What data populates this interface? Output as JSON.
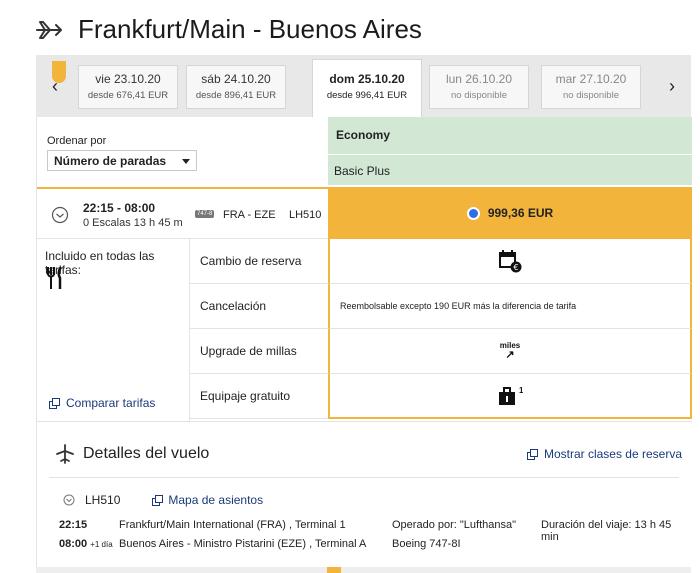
{
  "page": {
    "title": "Frankfurt/Main - Buenos Aires",
    "icons": {
      "title": "airplane-icon",
      "prev": "chevron-left-icon",
      "next": "chevron-right-icon"
    }
  },
  "dates": {
    "prev_label": "‹",
    "next_label": "›",
    "days": [
      {
        "label": "vie 23.10.20",
        "price": "desde 676,41 EUR",
        "state": "available"
      },
      {
        "label": "sáb 24.10.20",
        "price": "desde 896,41 EUR",
        "state": "available"
      },
      {
        "label": "dom 25.10.20",
        "price": "desde 996,41 EUR",
        "state": "selected"
      },
      {
        "label": "lun 26.10.20",
        "price": "no disponible",
        "state": "unavailable"
      },
      {
        "label": "mar 27.10.20",
        "price": "no disponible",
        "state": "unavailable"
      }
    ]
  },
  "sort": {
    "label": "Ordenar por",
    "value": "Número de paradas"
  },
  "fare": {
    "cabin": "Economy",
    "tier": "Basic Plus"
  },
  "flight": {
    "times": "22:15 - 08:00",
    "stops": "0 Escalas 13 h 45 m",
    "aircraft_badge": "747-8",
    "route": "FRA - EZE",
    "number": "LH510",
    "price": "999,36 EUR"
  },
  "features": {
    "included_label": "Incluido en todas las tarifas:",
    "compare_label": "Comparar tarifas",
    "rows": [
      {
        "name": "Cambio de reserva",
        "value": ""
      },
      {
        "name": "Cancelación",
        "value": "Reembolsable excepto 190 EUR más la diferencia de tarifa"
      },
      {
        "name": "Upgrade de millas",
        "value": "miles"
      },
      {
        "name": "Equipaje gratuito",
        "value": "1"
      }
    ],
    "currency_badge": "€",
    "upgrade_arrow": "↗"
  },
  "details": {
    "title": "Detalles del vuelo",
    "show_classes": "Mostrar clases de reserva",
    "segment": {
      "number": "LH510",
      "seat_map": "Mapa de asientos",
      "dep_time": "22:15",
      "dep_place": "Frankfurt/Main International (FRA) , Terminal 1",
      "arr_time": "08:00",
      "arr_plus": "+1 día",
      "arr_place": "Buenos Aires - Ministro Pistarini (EZE) , Terminal A",
      "operator": "Operado por: \"Lufthansa\"",
      "aircraft": "Boeing 747-8I",
      "duration": "Duración del viaje: 13 h 45 min"
    }
  },
  "colors": {
    "accent": "#f2b43b",
    "fare_header": "#d3e7d5",
    "link": "#1a3a7a",
    "radio": "#2a6ee8"
  }
}
